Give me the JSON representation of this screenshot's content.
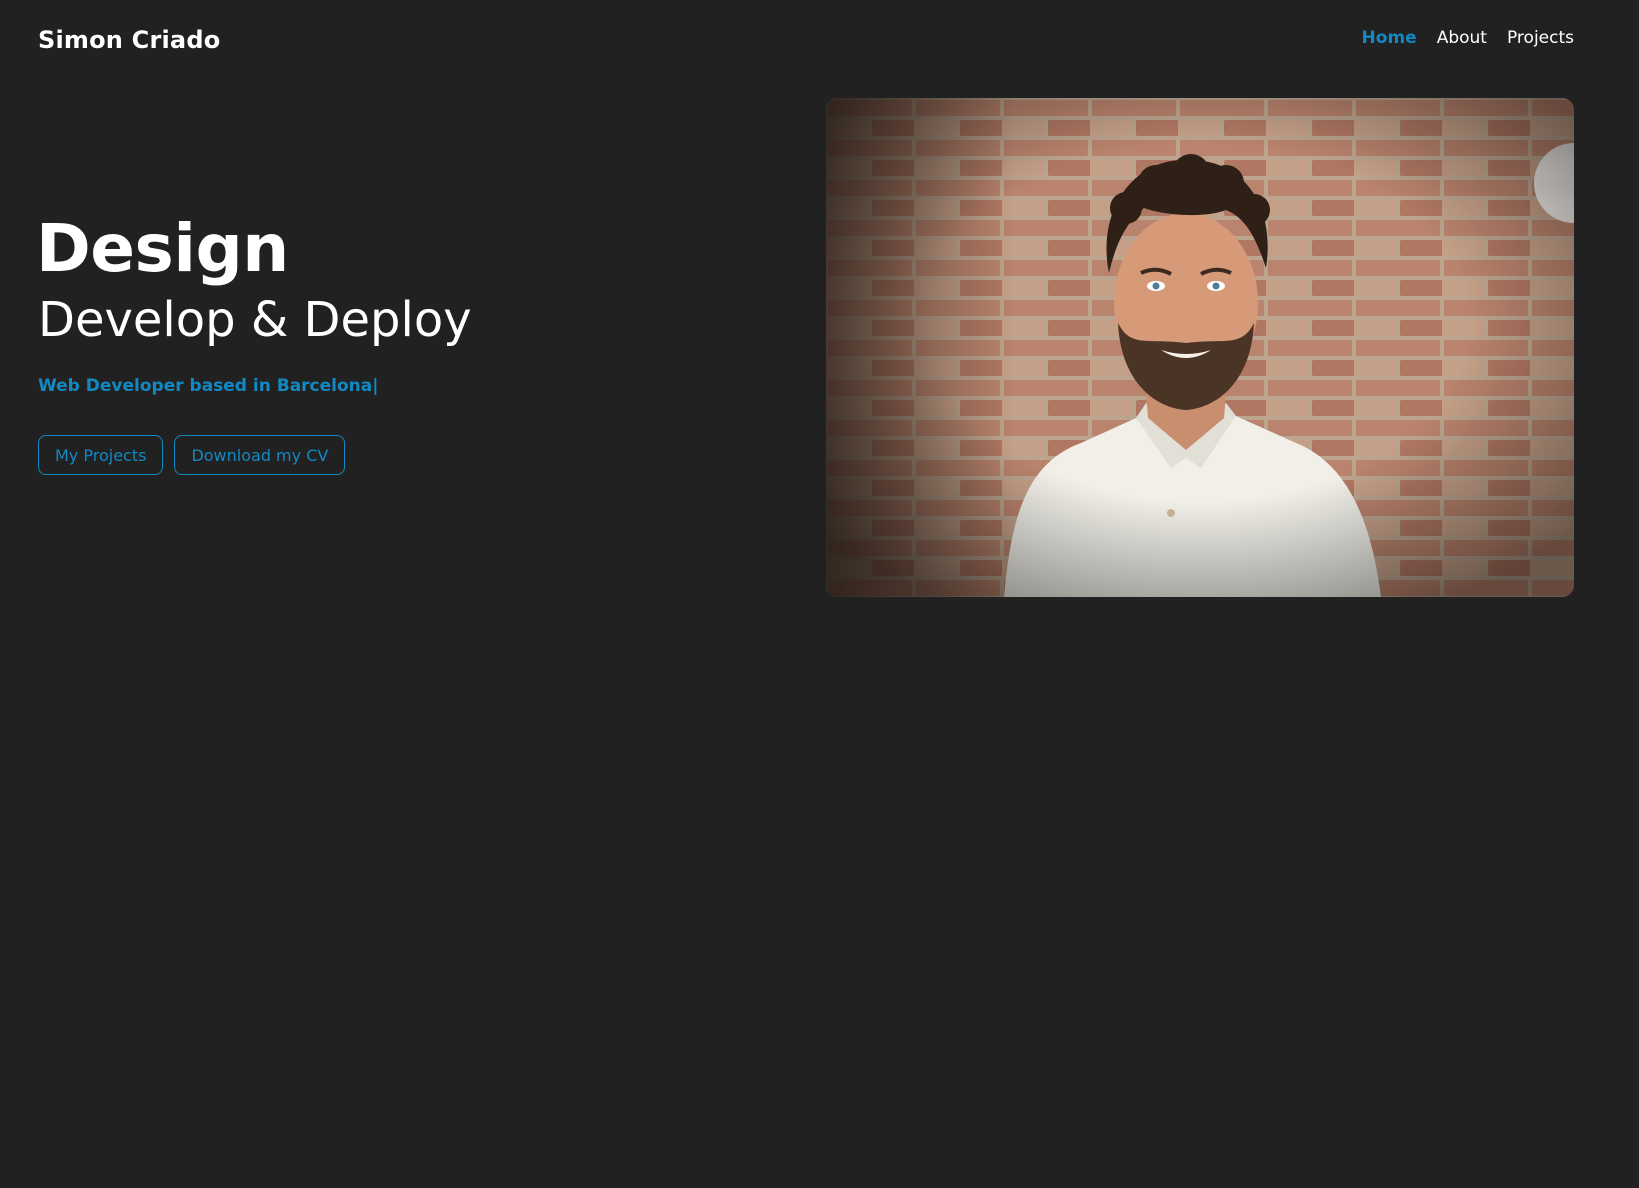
{
  "header": {
    "brand": "Simon Criado",
    "nav": [
      {
        "label": "Home",
        "active": true
      },
      {
        "label": "About",
        "active": false
      },
      {
        "label": "Projects",
        "active": false
      }
    ]
  },
  "hero": {
    "title": "Design",
    "subtitle": "Develop & Deploy",
    "tagline": "Web Developer based in Barcelona",
    "cursor": "|",
    "buttons": {
      "projects": "My Projects",
      "cv": "Download my CV"
    }
  },
  "photo": {
    "subject": "portrait-photo"
  },
  "colors": {
    "background": "#212121",
    "accent": "#1289c2",
    "text": "#ffffff"
  }
}
